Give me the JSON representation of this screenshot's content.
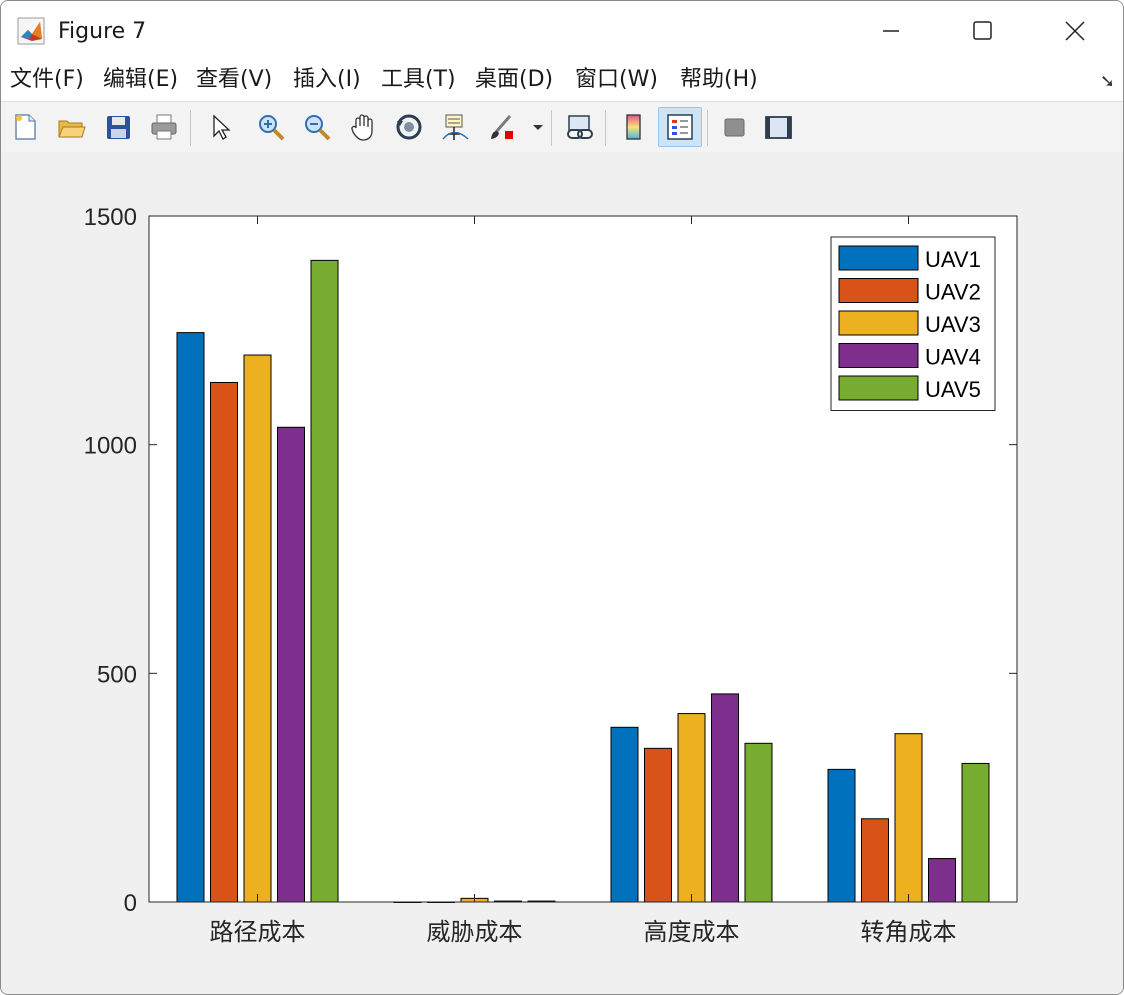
{
  "window": {
    "title": "Figure 7",
    "controls": {
      "minimize": "minimize-icon",
      "maximize": "maximize-icon",
      "close": "close-icon"
    }
  },
  "menu": [
    {
      "label": "文件(F)",
      "key": "F"
    },
    {
      "label": "编辑(E)",
      "key": "E"
    },
    {
      "label": "查看(V)",
      "key": "V"
    },
    {
      "label": "插入(I)",
      "key": "I"
    },
    {
      "label": "工具(T)",
      "key": "T"
    },
    {
      "label": "桌面(D)",
      "key": "D"
    },
    {
      "label": "窗口(W)",
      "key": "W"
    },
    {
      "label": "帮助(H)",
      "key": "H"
    }
  ],
  "menu_overflow_icon": "dock-arrow-icon",
  "toolbar": [
    "new-figure-icon",
    "open-file-icon",
    "save-icon",
    "print-icon",
    "select-pointer-icon",
    "zoom-in-icon",
    "zoom-out-icon",
    "pan-hand-icon",
    "rotate-3d-icon",
    "data-cursor-icon",
    "brush-icon",
    "brush-dropdown-icon",
    "link-plot-icon",
    "colorbar-icon",
    "legend-icon",
    "hide-plot-tools-icon",
    "show-plot-tools-icon"
  ],
  "colors": {
    "UAV1": "#0072BD",
    "UAV2": "#D95319",
    "UAV3": "#EDB120",
    "UAV4": "#7E2F8E",
    "UAV5": "#77AC30"
  },
  "chart_data": {
    "type": "bar",
    "categories": [
      "路径成本",
      "威胁成本",
      "高度成本",
      "转角成本"
    ],
    "series": [
      {
        "name": "UAV1",
        "values": [
          1245,
          0,
          382,
          290
        ]
      },
      {
        "name": "UAV2",
        "values": [
          1136,
          0,
          336,
          182
        ]
      },
      {
        "name": "UAV3",
        "values": [
          1196,
          8,
          412,
          368
        ]
      },
      {
        "name": "UAV4",
        "values": [
          1038,
          2,
          455,
          95
        ]
      },
      {
        "name": "UAV5",
        "values": [
          1403,
          2,
          347,
          303
        ]
      }
    ],
    "yticks": [
      "0",
      "500",
      "1000",
      "1500"
    ],
    "ylim": [
      0,
      1500
    ],
    "grid": false,
    "legend_position": "top-right"
  }
}
